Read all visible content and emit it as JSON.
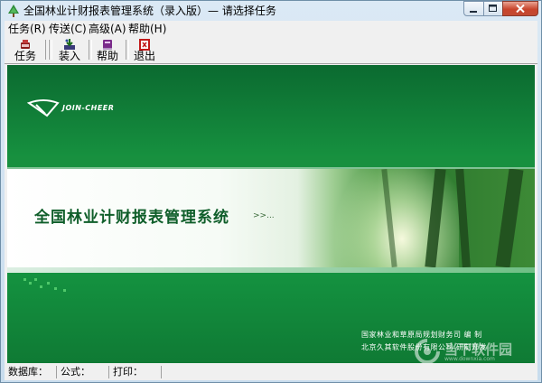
{
  "window": {
    "title": "全国林业计财报表管理系统（录入版）— 请选择任务"
  },
  "menu": {
    "items": [
      {
        "label": "任务(R)"
      },
      {
        "label": "传送(C)"
      },
      {
        "label": "高级(A)"
      },
      {
        "label": "帮助(H)"
      }
    ]
  },
  "toolbar": {
    "buttons": [
      {
        "label": "任务",
        "icon": "task-icon"
      },
      {
        "label": "装入",
        "icon": "load-icon"
      },
      {
        "label": "帮助",
        "icon": "help-book-icon"
      },
      {
        "label": "退出",
        "icon": "exit-icon"
      }
    ]
  },
  "splash": {
    "logo_text": "JOIN-CHEER",
    "system_title": "全国林业计财报表管理系统",
    "arrows": ">>...",
    "footer_line1": "国家林业和草原局规划财务司  编  制",
    "footer_line2": "北京久其软件股份有限公司  研制开发",
    "watermark_title": "当下软件园",
    "watermark_url": "www.downxia.com"
  },
  "statusbar": {
    "database_label": "数据库：",
    "formula_label": "公式：",
    "print_label": "打印："
  },
  "colors": {
    "splash_green": "#149240",
    "title_green": "#0f5e2a",
    "close_button_red": "#c8452d"
  }
}
